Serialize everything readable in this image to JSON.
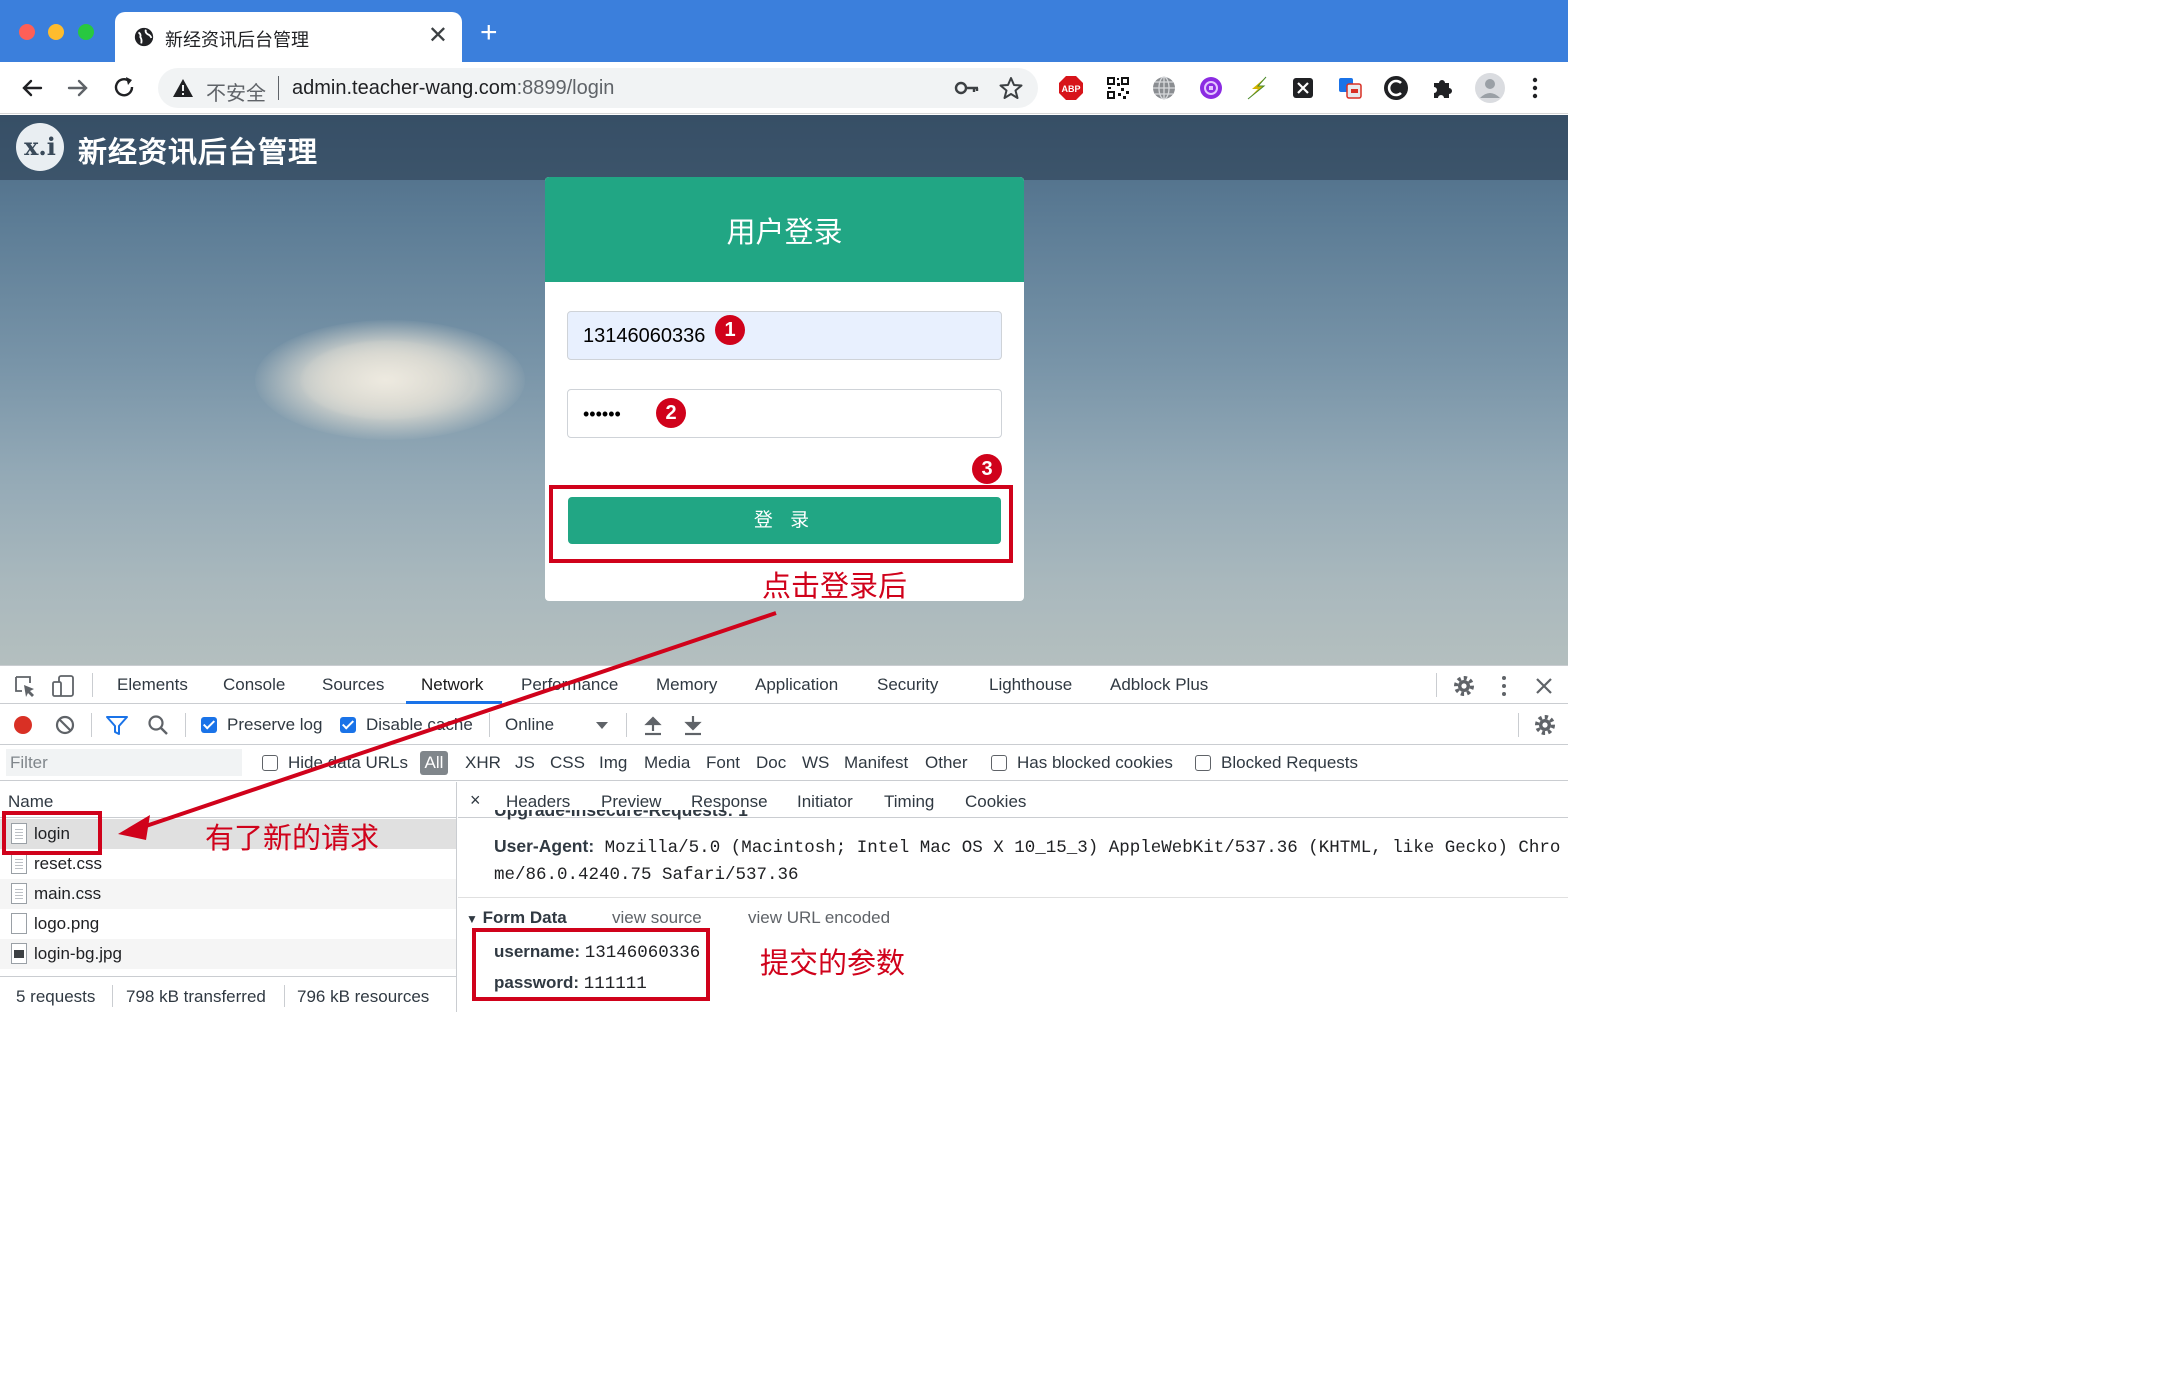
{
  "browser": {
    "tab_title": "新经资讯后台管理",
    "close_glyph": "✕",
    "new_tab_glyph": "+",
    "security_label": "不安全",
    "url_host": "admin.teacher-wang.com",
    "url_rest": ":8899/login",
    "extensions": [
      "adblock-plus-icon",
      "qr-code-icon",
      "globe-extension-icon",
      "purple-extension-icon",
      "lightning-extension-icon",
      "x-extension-icon",
      "translate-extension-icon",
      "c-extension-icon",
      "puzzle-extensions-icon",
      "profile-avatar-icon",
      "chrome-menu-icon"
    ]
  },
  "site": {
    "logo_text": "x.i",
    "title": "新经资讯后台管理"
  },
  "login": {
    "title": "用户登录",
    "username_value": "13146060336",
    "password_value": "••••••",
    "submit_label": "登 录"
  },
  "annotations": {
    "badge_1": "1",
    "badge_2": "2",
    "badge_3": "3",
    "after_click": "点击登录后",
    "new_request": "有了新的请求",
    "submitted_params": "提交的参数",
    "color": "#d0021b"
  },
  "devtools": {
    "tabs": [
      "Elements",
      "Console",
      "Sources",
      "Network",
      "Performance",
      "Memory",
      "Application",
      "Security",
      "Lighthouse",
      "Adblock Plus"
    ],
    "active_tab": "Network",
    "toolbar": {
      "preserve_log": "Preserve log",
      "disable_cache": "Disable cache",
      "throttling": "Online"
    },
    "filter_bar": {
      "filter_placeholder": "Filter",
      "hide_data_urls": "Hide data URLs",
      "types": [
        "All",
        "XHR",
        "JS",
        "CSS",
        "Img",
        "Media",
        "Font",
        "Doc",
        "WS",
        "Manifest",
        "Other"
      ],
      "has_blocked_cookies": "Has blocked cookies",
      "blocked_requests": "Blocked Requests"
    },
    "requests": {
      "column_name": "Name",
      "rows": [
        "login",
        "reset.css",
        "main.css",
        "logo.png",
        "login-bg.jpg"
      ],
      "summary_requests": "5 requests",
      "summary_transferred": "798 kB transferred",
      "summary_resources": "796 kB resources"
    },
    "detail": {
      "close_glyph": "×",
      "tabs": [
        "Headers",
        "Preview",
        "Response",
        "Initiator",
        "Timing",
        "Cookies"
      ],
      "partial_header": "Upgrade-Insecure-Requests: 1",
      "user_agent_key": "User-Agent:",
      "user_agent_line1": "Mozilla/5.0 (Macintosh; Intel Mac OS X 10_15_3) AppleWebKit/537.36 (KHTML, like Gecko) Chro",
      "user_agent_line2": "me/86.0.4240.75 Safari/537.36",
      "form_data_title": "Form Data",
      "view_source": "view source",
      "view_url_encoded": "view URL encoded",
      "fields": [
        {
          "key": "username:",
          "value": "13146060336"
        },
        {
          "key": "password:",
          "value": "111111"
        }
      ]
    }
  }
}
